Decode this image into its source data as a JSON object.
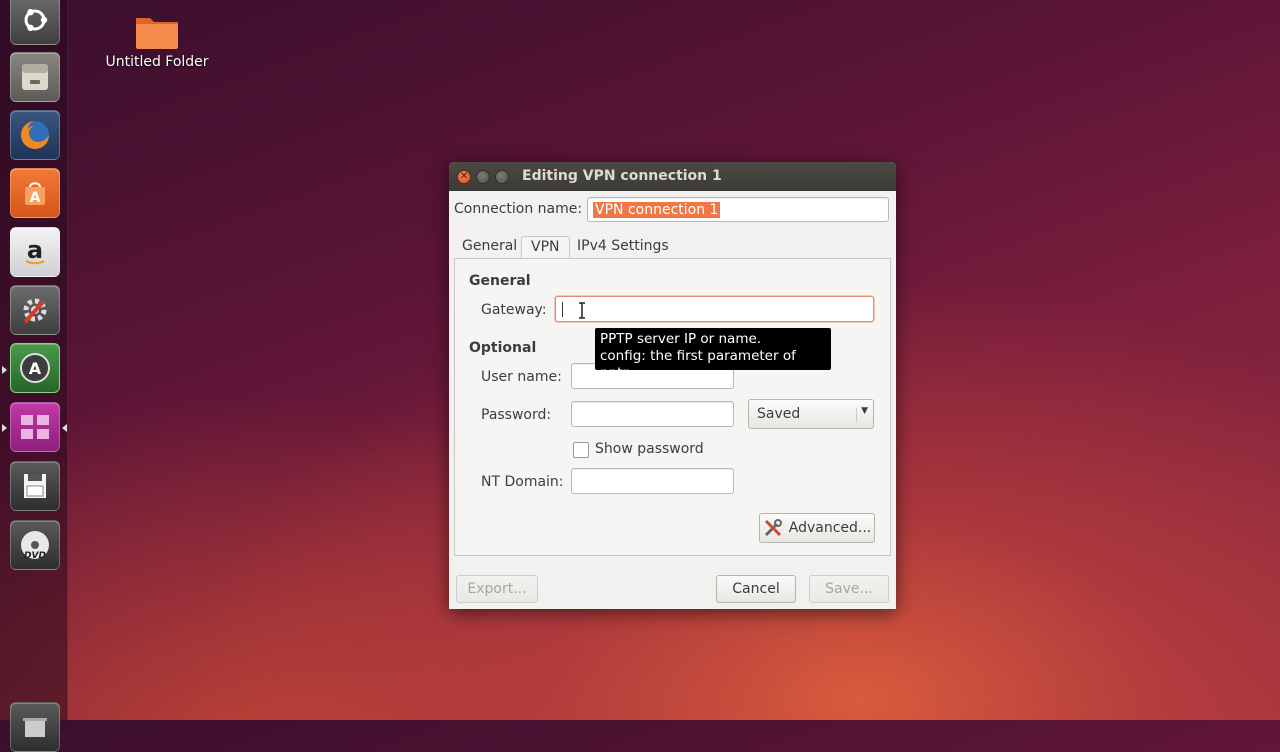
{
  "desktop": {
    "folder_label": "Untitled Folder"
  },
  "launcher": {
    "items": [
      "dash-home",
      "files",
      "firefox",
      "software-center",
      "amazon",
      "system-settings",
      "software-updater",
      "workspace-switcher",
      "disk",
      "dvd",
      "trash"
    ]
  },
  "dialog": {
    "title": "Editing VPN connection 1",
    "connection_name_label": "Connection name:",
    "connection_name_value": "VPN connection 1",
    "tabs": [
      {
        "label": "General"
      },
      {
        "label": "VPN"
      },
      {
        "label": "IPv4 Settings"
      }
    ],
    "active_tab": "VPN",
    "general_section": "General",
    "gateway_label": "Gateway:",
    "gateway_value": "",
    "tooltip_line1": "PPTP server IP or name.",
    "tooltip_line2": "config: the first parameter of pptp",
    "optional_section": "Optional",
    "username_label": "User name:",
    "username_value": "",
    "password_label": "Password:",
    "password_value": "",
    "password_storage": "Saved",
    "show_password_label": "Show password",
    "show_password_checked": false,
    "nt_domain_label": "NT Domain:",
    "nt_domain_value": "",
    "advanced_label": "Advanced...",
    "export_label": "Export...",
    "cancel_label": "Cancel",
    "save_label": "Save..."
  },
  "colors": {
    "accent": "#f07746",
    "titlebar": "#3c3b37"
  }
}
